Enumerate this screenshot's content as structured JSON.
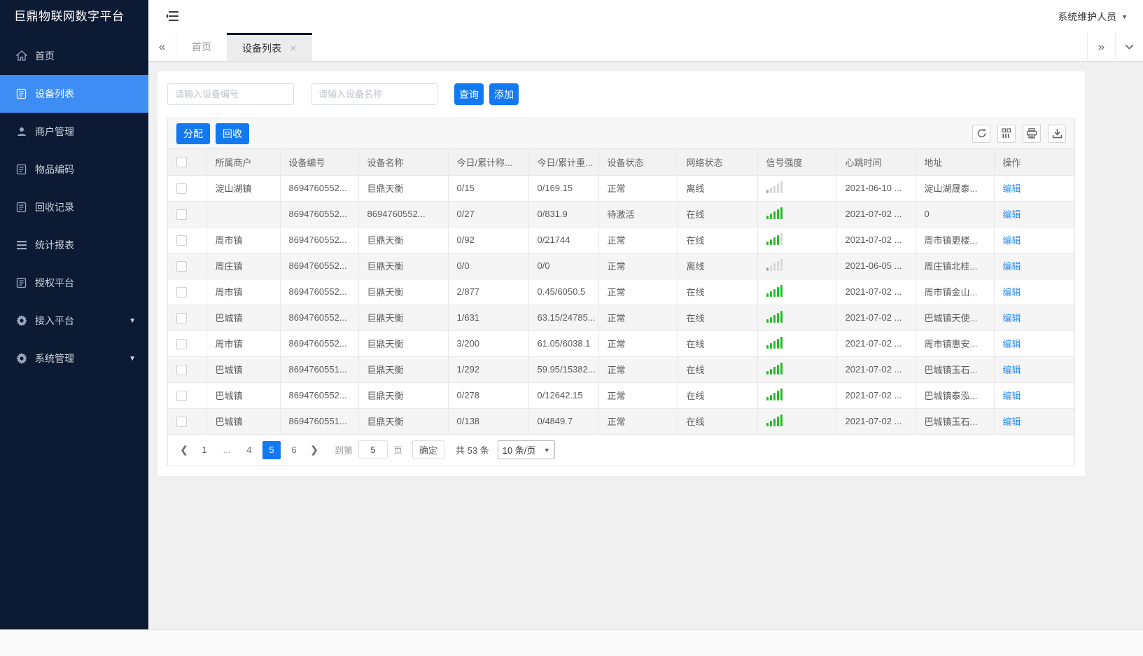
{
  "app": {
    "title": "巨鼎物联网数字平台",
    "user": "系统维护人员"
  },
  "colors": {
    "accent": "#1379f2",
    "sidebar_active": "#3e8df5",
    "online": "#19be6b",
    "offline": "#f5222d",
    "signal_green": "#22c122",
    "signal_gray": "#d8d8d8"
  },
  "sidebar": {
    "items": [
      {
        "label": "首页",
        "icon": "home-icon",
        "active": false,
        "caret": false
      },
      {
        "label": "设备列表",
        "icon": "doc-icon",
        "active": true,
        "caret": false
      },
      {
        "label": "商户管理",
        "icon": "user-icon",
        "active": false,
        "caret": false
      },
      {
        "label": "物品编码",
        "icon": "doc-icon",
        "active": false,
        "caret": false
      },
      {
        "label": "回收记录",
        "icon": "doc-icon",
        "active": false,
        "caret": false
      },
      {
        "label": "统计报表",
        "icon": "lines-icon",
        "active": false,
        "caret": false
      },
      {
        "label": "授权平台",
        "icon": "doc-icon",
        "active": false,
        "caret": false
      },
      {
        "label": "接入平台",
        "icon": "gear-icon",
        "active": false,
        "caret": true
      },
      {
        "label": "系统管理",
        "icon": "gear-icon",
        "active": false,
        "caret": true
      }
    ]
  },
  "tabs": {
    "items": [
      {
        "label": "首页",
        "active": false,
        "closable": false
      },
      {
        "label": "设备列表",
        "active": true,
        "closable": true
      }
    ]
  },
  "search": {
    "device_no_placeholder": "请输入设备编号",
    "device_name_placeholder": "请输入设备名称",
    "query_label": "查询",
    "add_label": "添加"
  },
  "toolbar": {
    "assign_label": "分配",
    "recycle_label": "回收",
    "icons": [
      "refresh-icon",
      "columns-icon",
      "printer-icon",
      "download-icon"
    ]
  },
  "table": {
    "headers": [
      "所属商户",
      "设备编号",
      "设备名称",
      "今日/累计称...",
      "今日/累计重...",
      "设备状态",
      "网络状态",
      "信号强度",
      "心跳时间",
      "地址",
      "操作"
    ],
    "rows": [
      {
        "merchant": "淀山湖镇",
        "device_no": "8694760552...",
        "device_name": "巨鼎天衡",
        "today_count": "0/15",
        "today_weight": "0/169.15",
        "device_status": "正常",
        "network_status": "离线",
        "online": false,
        "signal_level": 1,
        "signal_variant": "gray",
        "heartbeat": "2021-06-10 ...",
        "address": "淀山湖晟泰...",
        "action": "编辑"
      },
      {
        "merchant": "",
        "device_no": "8694760552...",
        "device_name": "8694760552...",
        "today_count": "0/27",
        "today_weight": "0/831.9",
        "device_status": "待激活",
        "network_status": "在线",
        "online": true,
        "signal_level": 5,
        "signal_variant": "green",
        "heartbeat": "2021-07-02 ...",
        "address": "0",
        "action": "编辑"
      },
      {
        "merchant": "周市镇",
        "device_no": "8694760552...",
        "device_name": "巨鼎天衡",
        "today_count": "0/92",
        "today_weight": "0/21744",
        "device_status": "正常",
        "network_status": "在线",
        "online": true,
        "signal_level": 4,
        "signal_variant": "green",
        "heartbeat": "2021-07-02 ...",
        "address": "周市镇更楼...",
        "action": "编辑"
      },
      {
        "merchant": "周庄镇",
        "device_no": "8694760552...",
        "device_name": "巨鼎天衡",
        "today_count": "0/0",
        "today_weight": "0/0",
        "device_status": "正常",
        "network_status": "离线",
        "online": false,
        "signal_level": 1,
        "signal_variant": "gray",
        "heartbeat": "2021-06-05 ...",
        "address": "周庄镇北桂...",
        "action": "编辑"
      },
      {
        "merchant": "周市镇",
        "device_no": "8694760552...",
        "device_name": "巨鼎天衡",
        "today_count": "2/877",
        "today_weight": "0.45/6050.5",
        "device_status": "正常",
        "network_status": "在线",
        "online": true,
        "signal_level": 5,
        "signal_variant": "green",
        "heartbeat": "2021-07-02 ...",
        "address": "周市镇金山...",
        "action": "编辑"
      },
      {
        "merchant": "巴城镇",
        "device_no": "8694760552...",
        "device_name": "巨鼎天衡",
        "today_count": "1/631",
        "today_weight": "63.15/24785...",
        "device_status": "正常",
        "network_status": "在线",
        "online": true,
        "signal_level": 5,
        "signal_variant": "green",
        "heartbeat": "2021-07-02 ...",
        "address": "巴城镇天使...",
        "action": "编辑"
      },
      {
        "merchant": "周市镇",
        "device_no": "8694760552...",
        "device_name": "巨鼎天衡",
        "today_count": "3/200",
        "today_weight": "61.05/6038.1",
        "device_status": "正常",
        "network_status": "在线",
        "online": true,
        "signal_level": 5,
        "signal_variant": "green",
        "heartbeat": "2021-07-02 ...",
        "address": "周市镇惠安...",
        "action": "编辑"
      },
      {
        "merchant": "巴城镇",
        "device_no": "8694760551...",
        "device_name": "巨鼎天衡",
        "today_count": "1/292",
        "today_weight": "59.95/15382...",
        "device_status": "正常",
        "network_status": "在线",
        "online": true,
        "signal_level": 5,
        "signal_variant": "green",
        "heartbeat": "2021-07-02 ...",
        "address": "巴城镇玉石...",
        "action": "编辑"
      },
      {
        "merchant": "巴城镇",
        "device_no": "8694760552...",
        "device_name": "巨鼎天衡",
        "today_count": "0/278",
        "today_weight": "0/12642.15",
        "device_status": "正常",
        "network_status": "在线",
        "online": true,
        "signal_level": 5,
        "signal_variant": "green",
        "heartbeat": "2021-07-02 ...",
        "address": "巴城镇泰泓...",
        "action": "编辑"
      },
      {
        "merchant": "巴城镇",
        "device_no": "8694760551...",
        "device_name": "巨鼎天衡",
        "today_count": "0/138",
        "today_weight": "0/4849.7",
        "device_status": "正常",
        "network_status": "在线",
        "online": true,
        "signal_level": 5,
        "signal_variant": "green",
        "heartbeat": "2021-07-02 ...",
        "address": "巴城镇玉石...",
        "action": "编辑"
      }
    ]
  },
  "pagination": {
    "pages": [
      {
        "label": "1",
        "active": false,
        "ellipsis": false
      },
      {
        "label": "...",
        "active": false,
        "ellipsis": true
      },
      {
        "label": "4",
        "active": false,
        "ellipsis": false
      },
      {
        "label": "5",
        "active": true,
        "ellipsis": false
      },
      {
        "label": "6",
        "active": false,
        "ellipsis": false
      }
    ],
    "goto_label": "到第",
    "goto_value": "5",
    "page_word": "页",
    "confirm_label": "确定",
    "total_label": "共 53 条",
    "page_size_label": "10 条/页"
  }
}
